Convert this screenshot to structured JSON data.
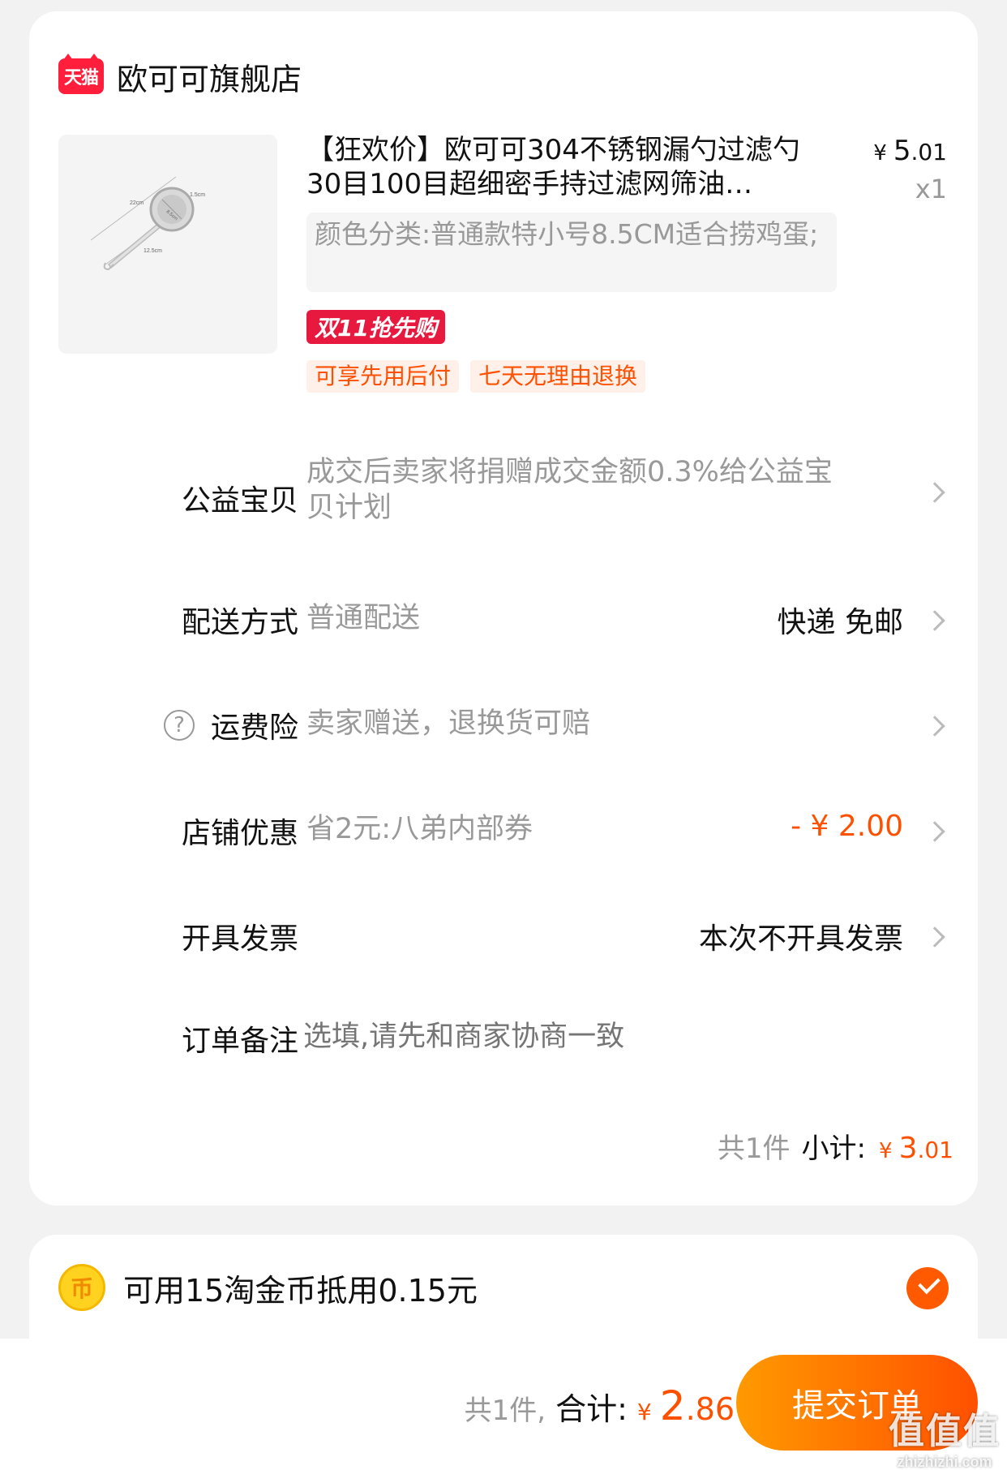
{
  "shop": {
    "logo_text": "天猫",
    "name": "欧可可旗舰店"
  },
  "product": {
    "title": "【狂欢价】欧可可304不锈钢漏勺过滤勺30目100目超细密手持过滤网筛油…",
    "price_currency": "¥",
    "price_int": "5",
    "price_dec": ".01",
    "quantity": "x1",
    "sku": "颜色分类:普通款特小号8.5CM适合捞鸡蛋;",
    "promo_tag": "双11抢先购",
    "service_tags": [
      "可享先用后付",
      "七天无理由退换"
    ],
    "image_labels": {
      "length": "22cm",
      "diameter": "8.5cm",
      "depth": "1.5cm",
      "handle": "12.5cm"
    }
  },
  "rows": {
    "charity": {
      "label": "公益宝贝",
      "value": "成交后卖家将捐赠成交金额0.3%给公益宝贝计划"
    },
    "delivery": {
      "label": "配送方式",
      "value": "普通配送",
      "right": "快递 免邮"
    },
    "insurance": {
      "icon": "?",
      "label": "运费险",
      "value": "卖家赠送，退换货可赔"
    },
    "discount": {
      "label": "店铺优惠",
      "value": "省2元:八弟内部券",
      "right": "- ¥ 2.00"
    },
    "invoice": {
      "label": "开具发票",
      "right": "本次不开具发票"
    },
    "note": {
      "label": "订单备注",
      "placeholder": "选填,请先和商家协商一致"
    }
  },
  "subtotal": {
    "count": "共1件",
    "label": "小计:",
    "currency": "¥",
    "int": "3",
    "dec": ".01"
  },
  "coins": {
    "icon": "币",
    "text": "可用15淘金币抵用0.15元",
    "checked": true
  },
  "bottom": {
    "count": "共1件,",
    "label": "合计:",
    "currency": "¥",
    "int": "2",
    "dec": ".86",
    "submit_label": "提交订单"
  },
  "watermark": {
    "main": "值值值",
    "sub": "zhizhizhi.com"
  },
  "colors": {
    "accent": "#ff5000",
    "tmall_red": "#ff1f3c",
    "promo_red": "#e8193f",
    "muted": "#999999",
    "background": "#f2f2f2"
  }
}
